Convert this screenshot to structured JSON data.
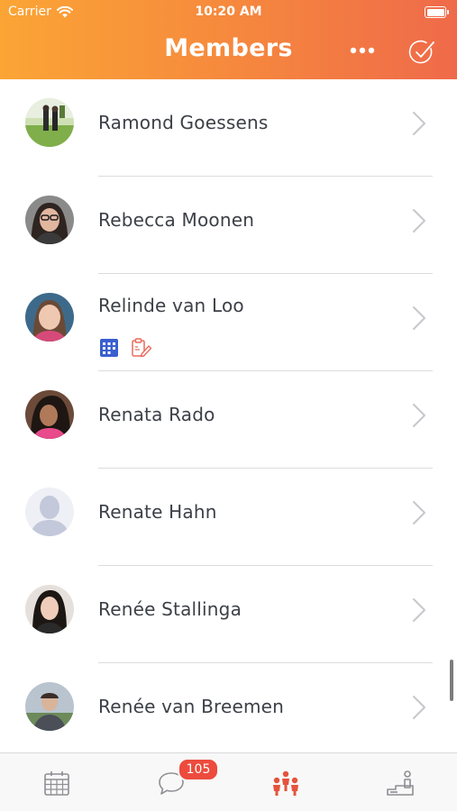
{
  "status_bar": {
    "carrier": "Carrier",
    "time": "10:20 AM"
  },
  "header": {
    "title": "Members",
    "more_icon": "ellipsis-icon",
    "done_icon": "checkmark-circle-icon"
  },
  "members": [
    {
      "name": "Ramond Goessens",
      "avatar": "photo"
    },
    {
      "name": "Rebecca Moonen",
      "avatar": "photo"
    },
    {
      "name": "Relinde van Loo",
      "avatar": "photo",
      "badges": [
        "calendar-grid-icon",
        "clipboard-edit-icon"
      ]
    },
    {
      "name": "Renata Rado",
      "avatar": "photo"
    },
    {
      "name": "Renate Hahn",
      "avatar": "placeholder-person"
    },
    {
      "name": "Renée Stallinga",
      "avatar": "photo"
    },
    {
      "name": "Renée van Breemen",
      "avatar": "photo"
    }
  ],
  "tabbar": {
    "tabs": [
      {
        "id": "calendar",
        "icon": "calendar-icon",
        "active": false
      },
      {
        "id": "chat",
        "icon": "chat-bubble-icon",
        "active": false,
        "badge": "105"
      },
      {
        "id": "members",
        "icon": "people-icon",
        "active": true
      },
      {
        "id": "stats",
        "icon": "podium-person-icon",
        "active": false
      }
    ]
  },
  "colors": {
    "header_start": "#fba535",
    "header_end": "#ef6a4a",
    "accent": "#e5533d",
    "badge_red": "#ec4b3d",
    "name_text": "#3c4047",
    "calendar_badge_blue": "#3a5fcf",
    "clipboard_badge_red": "#e86b5d"
  }
}
